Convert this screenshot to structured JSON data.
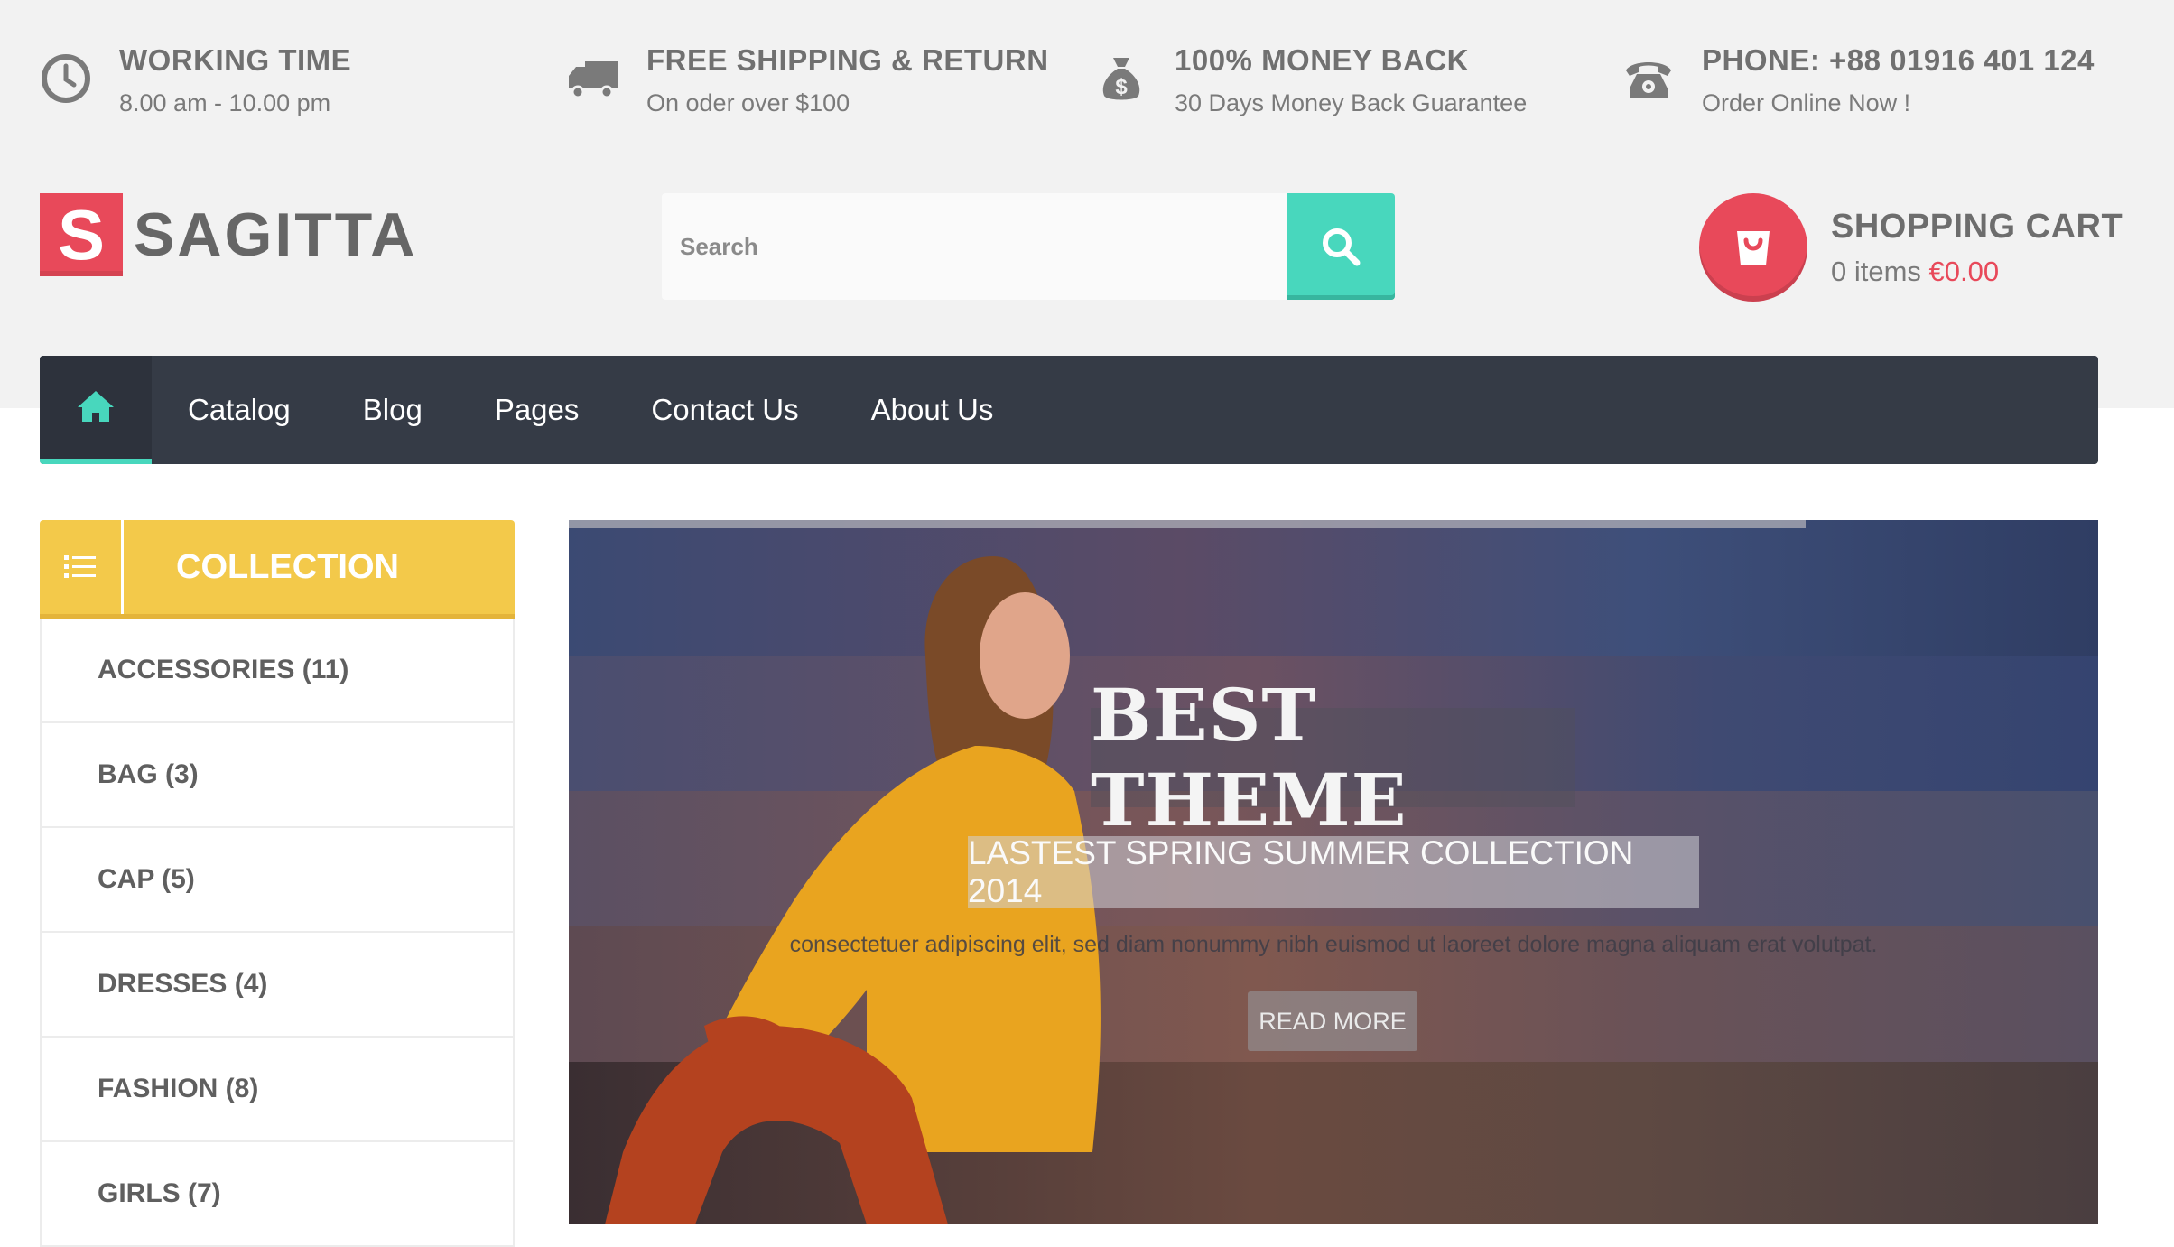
{
  "info_bar": [
    {
      "icon": "clock-icon",
      "title": "WORKING TIME",
      "subtitle": "8.00 am - 10.00 pm"
    },
    {
      "icon": "truck-icon",
      "title": "FREE SHIPPING & RETURN",
      "subtitle": "On oder over $100"
    },
    {
      "icon": "money-bag-icon",
      "title": "100% MONEY BACK",
      "subtitle": "30 Days Money Back Guarantee"
    },
    {
      "icon": "telephone-icon",
      "title": "PHONE: +88 01916 401 124",
      "subtitle": "Order Online Now !"
    }
  ],
  "logo": {
    "letter": "S",
    "name": "SAGITTA"
  },
  "search": {
    "placeholder": "Search"
  },
  "cart": {
    "title": "SHOPPING CART",
    "items": "0 items",
    "price": "€0.00"
  },
  "nav": {
    "items": [
      "Catalog",
      "Blog",
      "Pages",
      "Contact Us",
      "About Us"
    ]
  },
  "collection": {
    "title": "COLLECTION",
    "items": [
      "ACCESSORIES (11)",
      "BAG (3)",
      "CAP (5)",
      "DRESSES (4)",
      "FASHION (8)",
      "GIRLS (7)"
    ]
  },
  "slide": {
    "title": "BEST THEME",
    "subtitle": "LASTEST SPRING SUMMER COLLECTION 2014",
    "description": "consectetuer adipiscing elit, sed diam nonummy nibh euismod ut laoreet dolore magna aliquam erat volutpat.",
    "button": "READ MORE"
  },
  "colors": {
    "accent": "#48d7bd",
    "brand": "#e8495a",
    "collection": "#f3c94a",
    "nav": "#353b46"
  }
}
